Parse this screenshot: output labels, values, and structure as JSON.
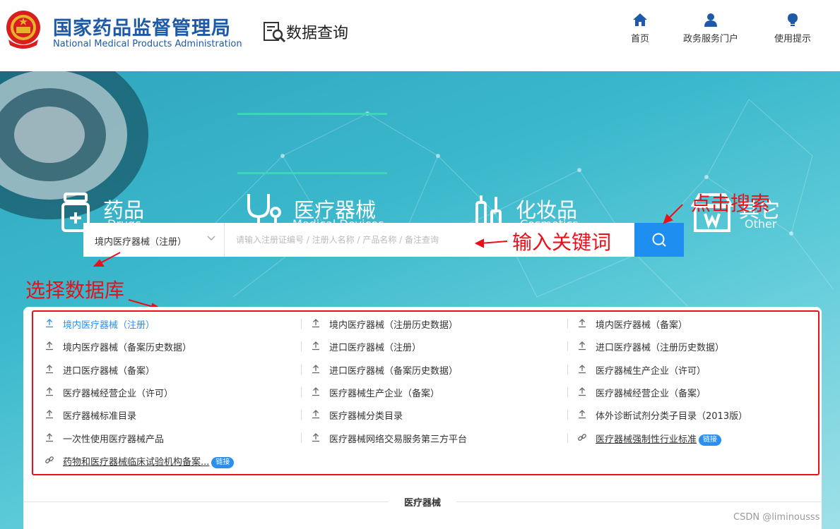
{
  "header": {
    "brand_cn": "国家药品监督管理局",
    "brand_en": "National Medical Products Administration",
    "data_query": "数据查询",
    "nav": [
      {
        "label": "首页",
        "icon": "home-icon"
      },
      {
        "label": "政务服务门户",
        "icon": "user-icon"
      },
      {
        "label": "使用提示",
        "icon": "bulb-icon"
      }
    ]
  },
  "categories": [
    {
      "cn": "药品",
      "en": "Drugs",
      "icon": "medicine-bottle-icon",
      "active": false
    },
    {
      "cn": "医疗器械",
      "en": "Medical Devices",
      "icon": "stethoscope-icon",
      "active": true
    },
    {
      "cn": "化妆品",
      "en": "Cosmetics",
      "icon": "cosmetics-icon",
      "active": false
    },
    {
      "cn": "其它",
      "en": "Other",
      "icon": "store-icon",
      "active": false
    }
  ],
  "search": {
    "selected_db": "境内医疗器械（注册）",
    "placeholder": "请输入注册证编号 / 注册人名称 / 产品名称 / 备注查询"
  },
  "annotations": {
    "click_search": "点击搜索",
    "enter_keyword": "输入关键词",
    "choose_db": "选择数据库"
  },
  "databases": [
    {
      "label": "境内医疗器械（注册）",
      "type": "upload",
      "active": true
    },
    {
      "label": "境内医疗器械（注册历史数据）",
      "type": "upload",
      "active": false
    },
    {
      "label": "境内医疗器械（备案）",
      "type": "upload",
      "active": false
    },
    {
      "label": "境内医疗器械（备案历史数据）",
      "type": "upload",
      "active": false
    },
    {
      "label": "进口医疗器械（注册）",
      "type": "upload",
      "active": false
    },
    {
      "label": "进口医疗器械（注册历史数据）",
      "type": "upload",
      "active": false
    },
    {
      "label": "进口医疗器械（备案）",
      "type": "upload",
      "active": false
    },
    {
      "label": "进口医疗器械（备案历史数据）",
      "type": "upload",
      "active": false
    },
    {
      "label": "医疗器械生产企业（许可）",
      "type": "upload",
      "active": false
    },
    {
      "label": "医疗器械经营企业（许可）",
      "type": "upload",
      "active": false
    },
    {
      "label": "医疗器械生产企业（备案）",
      "type": "upload",
      "active": false
    },
    {
      "label": "医疗器械经营企业（备案）",
      "type": "upload",
      "active": false
    },
    {
      "label": "医疗器械标准目录",
      "type": "upload",
      "active": false
    },
    {
      "label": "医疗器械分类目录",
      "type": "upload",
      "active": false
    },
    {
      "label": "体外诊断试剂分类子目录（2013版）",
      "type": "upload",
      "active": false
    },
    {
      "label": "一次性使用医疗器械产品",
      "type": "upload",
      "active": false
    },
    {
      "label": "医疗器械网络交易服务第三方平台",
      "type": "upload",
      "active": false
    },
    {
      "label": "医疗器械强制性行业标准",
      "type": "link",
      "badge": "链接",
      "active": false
    },
    {
      "label": "药物和医疗器械临床试验机构备案...",
      "type": "link",
      "badge": "链接",
      "active": false
    }
  ],
  "footer": {
    "section_title": "医疗器械",
    "watermark": "CSDN @liminousss"
  },
  "colors": {
    "brand": "#1f5aa8",
    "accent": "#1e8ff0",
    "annotation": "#e8101a",
    "active_tab_line": "#3ed6b9"
  }
}
